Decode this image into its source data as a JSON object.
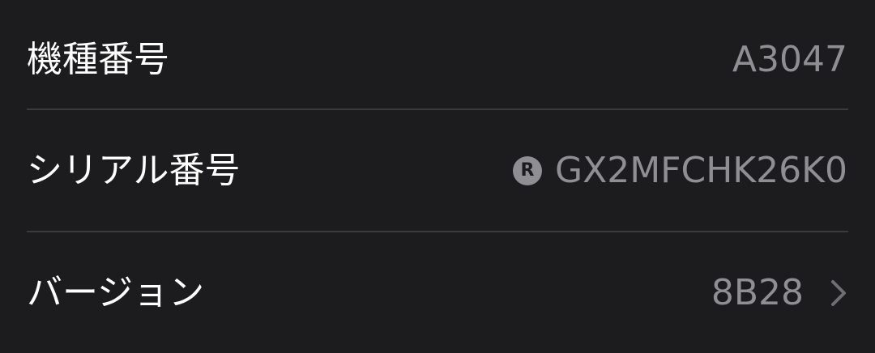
{
  "rows": [
    {
      "label": "機種番号",
      "value": "A3047"
    },
    {
      "label": "シリアル番号",
      "value": "GX2MFCHK26K0",
      "badge": "R",
      "badge_icon": "registered-icon"
    },
    {
      "label": "バージョン",
      "value": "8B28",
      "disclosure_icon": "chevron-right-icon"
    }
  ],
  "colors": {
    "background": "#1c1c1e",
    "label": "#ffffff",
    "value": "#8e8e93",
    "divider": "#3a3a3c"
  }
}
